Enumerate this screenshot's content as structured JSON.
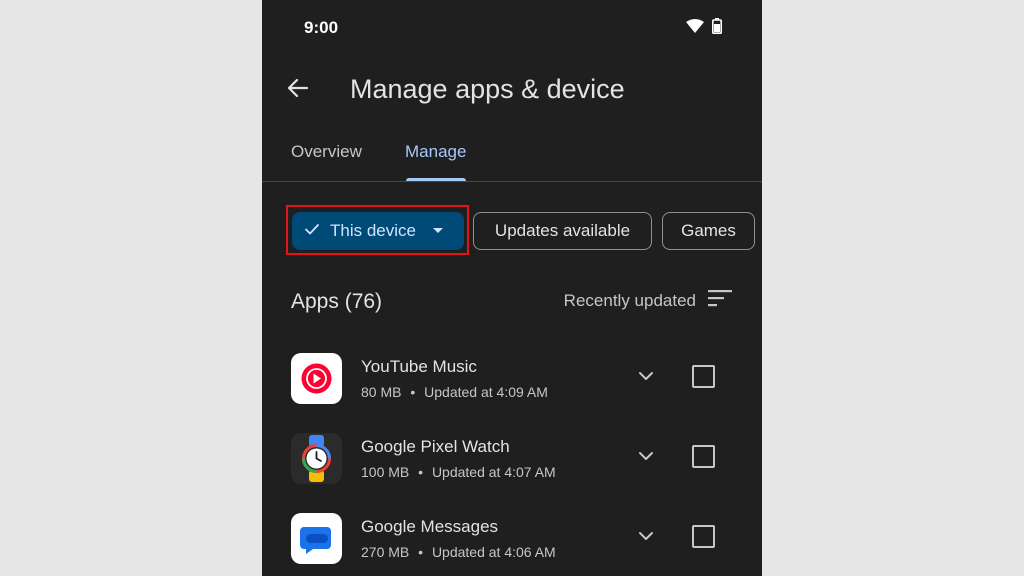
{
  "status_bar": {
    "time": "9:00"
  },
  "app_bar": {
    "title": "Manage apps & device"
  },
  "tabs": [
    {
      "label": "Overview"
    },
    {
      "label": "Manage",
      "selected": true
    }
  ],
  "filters": {
    "selected": {
      "label": "This device"
    },
    "updates": {
      "label": "Updates available"
    },
    "games": {
      "label": "Games"
    }
  },
  "apps_section": {
    "header": "Apps (76)",
    "sort_label": "Recently updated"
  },
  "apps": [
    {
      "name": "YouTube Music",
      "size": "80 MB",
      "updated": "Updated at 4:09 AM",
      "icon": "youtube-music-icon"
    },
    {
      "name": "Google Pixel Watch",
      "size": "100 MB",
      "updated": "Updated at 4:07 AM",
      "icon": "pixel-watch-icon"
    },
    {
      "name": "Google Messages",
      "size": "270 MB",
      "updated": "Updated at 4:06 AM",
      "icon": "messages-icon"
    }
  ],
  "separator": "•",
  "colors": {
    "background": "#1f1f1f",
    "accent": "#a8c7fa",
    "chip_selected_bg": "#004a77",
    "highlight_border": "#e4141c"
  }
}
